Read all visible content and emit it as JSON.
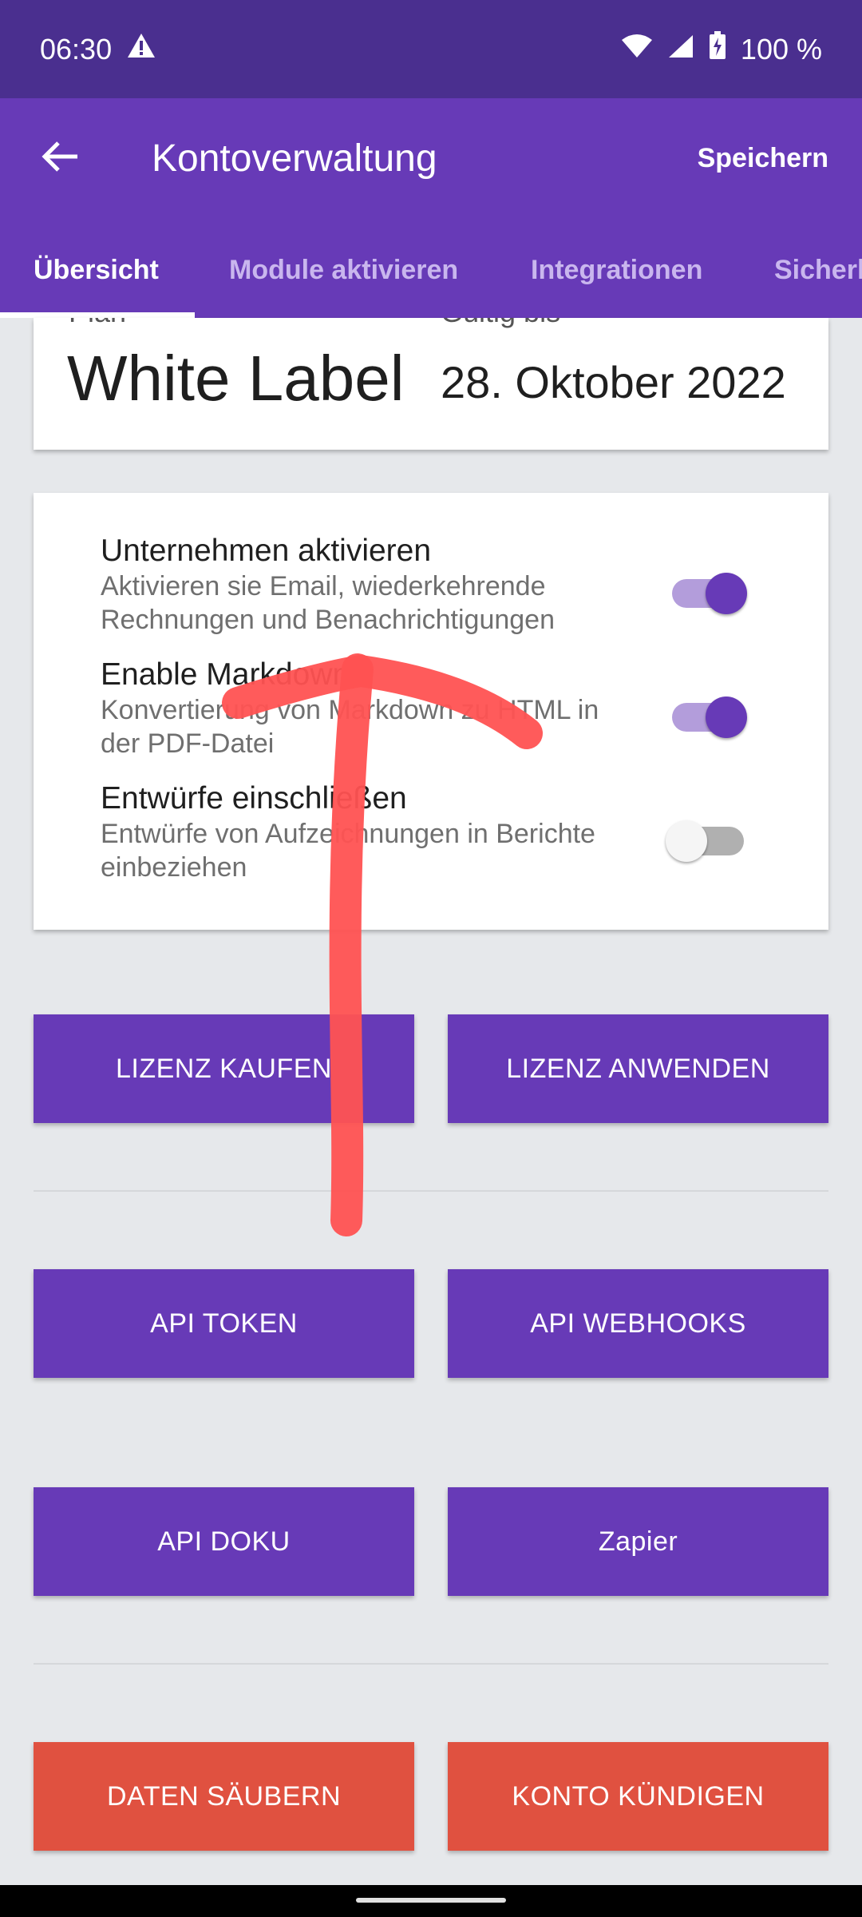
{
  "status_bar": {
    "time": "06:30",
    "battery": "100 %",
    "icons": [
      "warning-icon",
      "wifi-icon",
      "signal-icon",
      "battery-charging-icon"
    ]
  },
  "app_bar": {
    "title": "Kontoverwaltung",
    "save_label": "Speichern",
    "back_icon": "arrow-left-icon"
  },
  "tabs": [
    {
      "label": "Übersicht",
      "active": true
    },
    {
      "label": "Module aktivieren",
      "active": false
    },
    {
      "label": "Integrationen",
      "active": false
    },
    {
      "label": "Sicherh",
      "active": false
    }
  ],
  "plan_card": {
    "plan_label": "Plan",
    "plan_value": "White Label",
    "valid_label": "Gültig bis",
    "valid_value": "28. Oktober 2022"
  },
  "settings": [
    {
      "title": "Unternehmen aktivieren",
      "description": "Aktivieren sie Email, wiederkehrende Rechnungen und Benachrichtigungen",
      "enabled": true
    },
    {
      "title": "Enable Markdown",
      "description": "Konvertierung von Markdown zu HTML in der PDF-Datei",
      "enabled": true
    },
    {
      "title": "Entwürfe einschließen",
      "description": "Entwürfe von Aufzeichnungen in Berichte einbeziehen",
      "enabled": false
    }
  ],
  "buttons": {
    "buy_license": "LIZENZ KAUFEN",
    "apply_license": "LIZENZ ANWENDEN",
    "api_token": "API TOKEN",
    "api_webhooks": "API WEBHOOKS",
    "api_docs": "API DOKU",
    "zapier": "Zapier",
    "purge_data": "DATEN SÄUBERN",
    "cancel_account": "KONTO KÜNDIGEN"
  },
  "colors": {
    "primary": "#673ab7",
    "status_bar": "#4a2f8f",
    "danger": "#e05140",
    "annotation_stroke": "#ff5252"
  },
  "annotation": {
    "type": "hand-drawn-arrow",
    "direction": "up"
  }
}
